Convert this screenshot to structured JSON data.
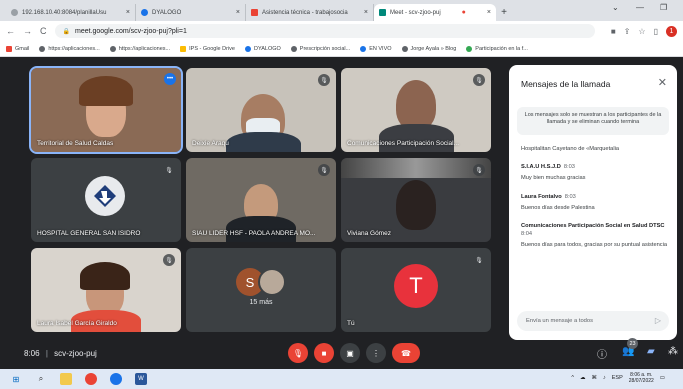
{
  "browser": {
    "tabs": [
      {
        "title": "192.168.10.40:8084/planillaUsu",
        "icon": "page-icon",
        "color": "#9aa0a6"
      },
      {
        "title": "DYALOGO",
        "icon": "dyalogo-icon",
        "color": "#1a73e8"
      },
      {
        "title": "Asistencia técnica - trabajosocia",
        "icon": "gmail-icon",
        "color": "#ea4335"
      },
      {
        "title": "Meet - scv-zjoo-puj",
        "icon": "meet-icon",
        "color": "#00897b",
        "active": true
      }
    ],
    "url": "meet.google.com/scv-zjoo-puj?pli=1",
    "bookmarks": [
      {
        "label": "Gmail",
        "color": "#ea4335"
      },
      {
        "label": "https://aplicaciones...",
        "color": "#5f6368"
      },
      {
        "label": "https://aplicaciones...",
        "color": "#5f6368"
      },
      {
        "label": "IPS - Google Drive",
        "color": "#fbbc04"
      },
      {
        "label": "DYALOGO",
        "color": "#1a73e8"
      },
      {
        "label": "Prescripción social...",
        "color": "#5f6368"
      },
      {
        "label": "EN VIVO",
        "color": "#1a73e8"
      },
      {
        "label": "Jorge Ayala » Blog",
        "color": "#5f6368"
      },
      {
        "label": "Participación en la f...",
        "color": "#34a853"
      }
    ],
    "profile_initial": "1"
  },
  "meet": {
    "tiles": [
      {
        "name": "Territorial de Salud Caldas"
      },
      {
        "name": "Deixie Araqu"
      },
      {
        "name": "Comunicaciones Participación Social..."
      },
      {
        "name": "HOSPITAL GENERAL SAN ISIDRO"
      },
      {
        "name": "SIAU LIDER HSF - PAOLA ANDREA MO..."
      },
      {
        "name": "Viviana Gómez"
      },
      {
        "name": "Laura Isabel García Giraldo"
      },
      {
        "name": "15 más",
        "avatar_letter": "S"
      },
      {
        "name": "Tú",
        "avatar_letter": "T"
      }
    ],
    "meeting_time": "8:06",
    "meeting_code": "scv-zjoo-puj",
    "participant_count": "23"
  },
  "chat": {
    "title": "Mensajes de la llamada",
    "notice": "Los mensajes solo se muestran a los participantes de la llamada y se eliminan cuando termina",
    "messages": [
      {
        "sender": "Hospitalitan Cayetano de «Marquetalia",
        "time": "",
        "text": ""
      },
      {
        "sender": "S.I.A.U H.S.J.D",
        "time": "8:03",
        "text": "Muy bien muchas gracias"
      },
      {
        "sender": "Laura Fontalvo",
        "time": "8:03",
        "text": "Buenos días desde Palestina"
      },
      {
        "sender": "Comunicaciones Participación Social en Salud DTSC",
        "time": "8:04",
        "text": "Buenos días para todos, gracias por su puntual asistencia"
      }
    ],
    "input_placeholder": "Envía un mensaje a todos"
  },
  "taskbar": {
    "lang": "ESP",
    "time": "8:06 a. m.",
    "date": "28/07/2022"
  }
}
